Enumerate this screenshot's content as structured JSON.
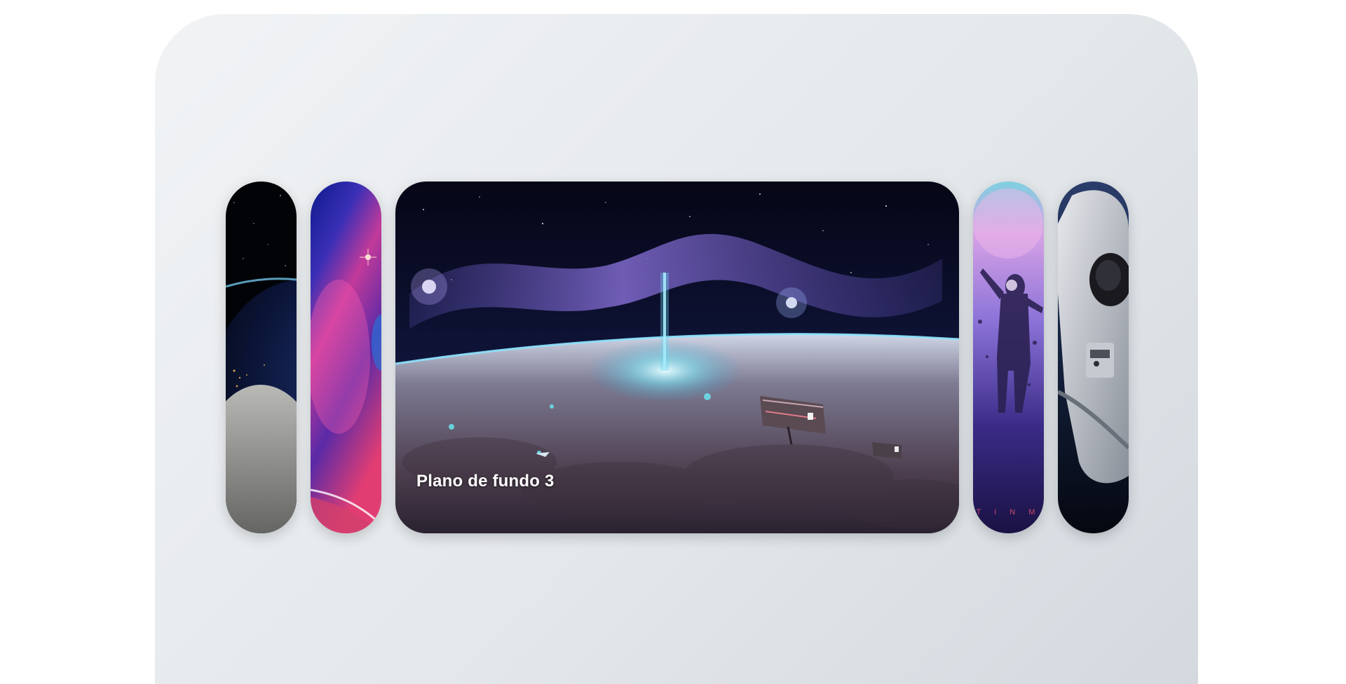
{
  "slider": {
    "active_index": 2,
    "panels": [
      {
        "icon": "earth-moon-image"
      },
      {
        "icon": "nebula-planet-image"
      },
      {
        "icon": "spaceships-over-planet-image",
        "title": "Plano de fundo 3"
      },
      {
        "icon": "floating-astronaut-image",
        "credit": "T I N M"
      },
      {
        "icon": "astronaut-closeup-image"
      }
    ]
  }
}
